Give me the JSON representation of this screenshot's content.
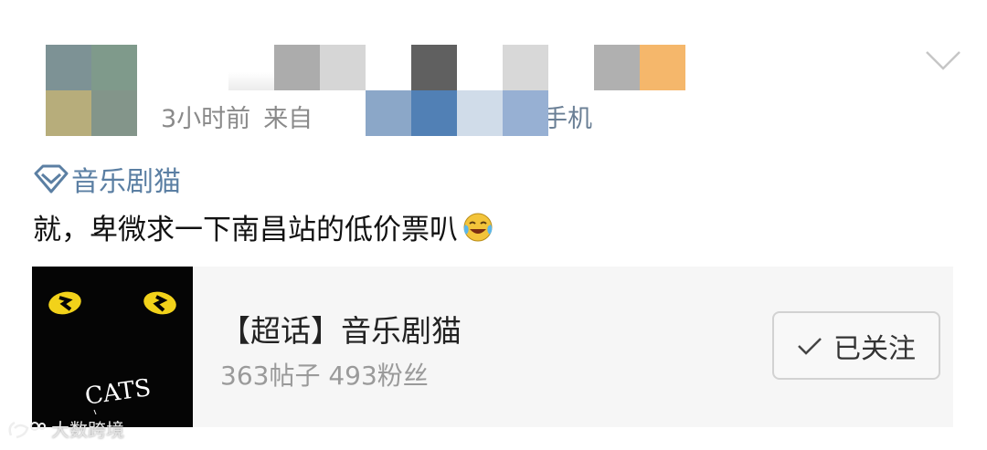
{
  "post": {
    "meta_time": "3小时前",
    "meta_source_prefix": "来自",
    "meta_source_suffix": "手机",
    "topic_label": "音乐剧猫",
    "text": "就，卑微求一下南昌站的低价票叭"
  },
  "card": {
    "title": "【超话】音乐剧猫",
    "stats": "363帖子 493粉丝",
    "follow_label": "已关注",
    "thumb_text": "CATS"
  },
  "watermark": {
    "text": "大数跨境"
  },
  "icons": {
    "topic": "diamond-icon",
    "more": "chevron-down-icon",
    "follow": "check-icon",
    "emoji": "laugh-cry-emoji-icon"
  },
  "colors": {
    "link_blue": "#5b7fa3",
    "meta_gray": "#8a8a8a",
    "card_bg": "#f6f6f6"
  }
}
